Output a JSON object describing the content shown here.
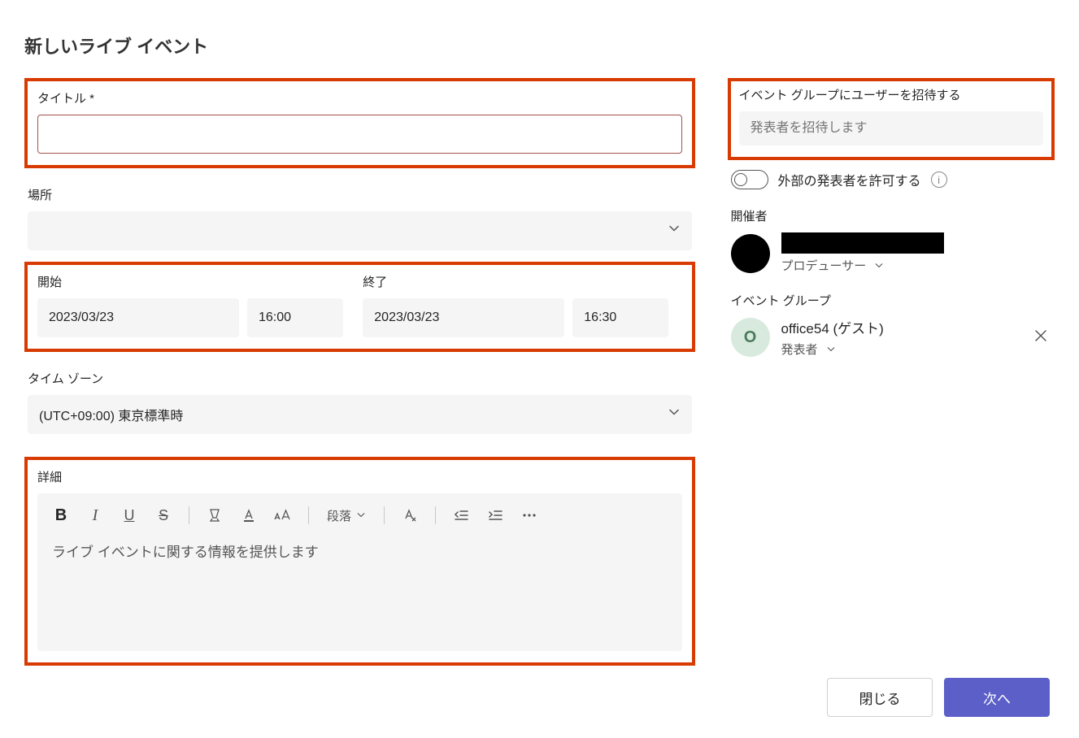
{
  "page": {
    "title": "新しいライブ イベント"
  },
  "left": {
    "title": {
      "label": "タイトル *",
      "value": ""
    },
    "location": {
      "label": "場所",
      "value": ""
    },
    "start": {
      "label": "開始",
      "date": "2023/03/23",
      "time": "16:00"
    },
    "end": {
      "label": "終了",
      "date": "2023/03/23",
      "time": "16:30"
    },
    "timezone": {
      "label": "タイム ゾーン",
      "value": "(UTC+09:00) 東京標準時"
    },
    "details": {
      "label": "詳細",
      "placeholder": "ライブ イベントに関する情報を提供します",
      "paragraph_label": "段落"
    }
  },
  "right": {
    "invite": {
      "label": "イベント グループにユーザーを招待する",
      "placeholder": "発表者を招待します"
    },
    "allow_external": {
      "label": "外部の発表者を許可する"
    },
    "organizer": {
      "section_label": "開催者",
      "role": "プロデューサー"
    },
    "event_group": {
      "section_label": "イベント グループ",
      "avatar_letter": "O",
      "name": "office54 (ゲスト)",
      "role": "発表者"
    }
  },
  "footer": {
    "close": "閉じる",
    "next": "次へ"
  }
}
